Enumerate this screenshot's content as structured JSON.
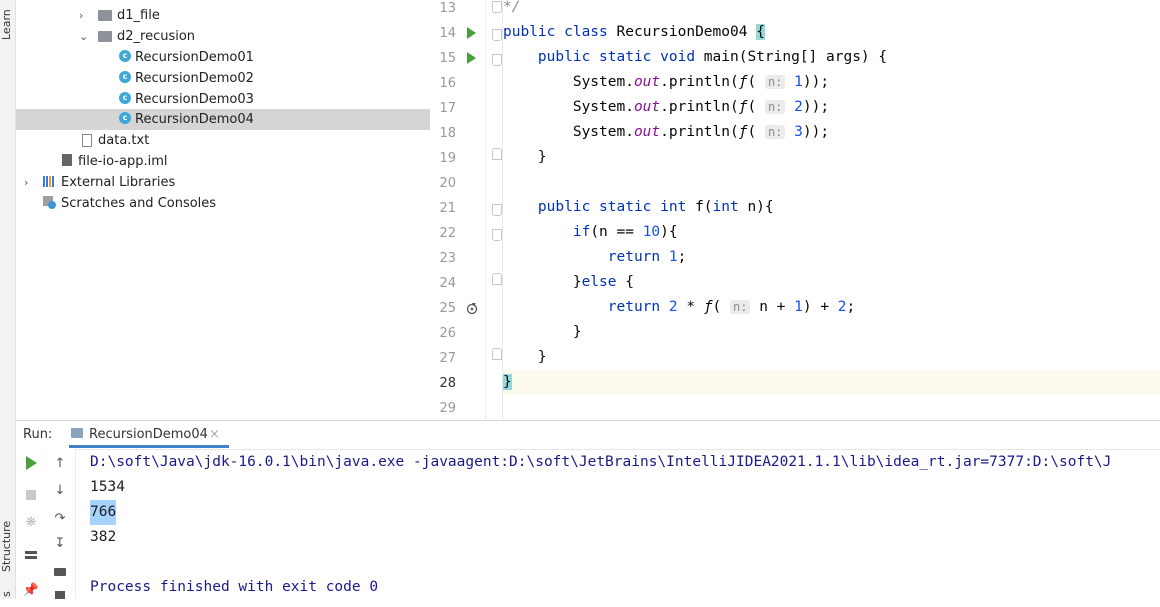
{
  "side_strip": {
    "top_label": "Learn",
    "bottom_label": "Structure",
    "bottom2_label": "s"
  },
  "project_tree": [
    {
      "label": "d1_file",
      "type": "folder",
      "expanded": false
    },
    {
      "label": "d2_recusion",
      "type": "folder",
      "expanded": true
    },
    {
      "label": "RecursionDemo01",
      "type": "class"
    },
    {
      "label": "RecursionDemo02",
      "type": "class"
    },
    {
      "label": "RecursionDemo03",
      "type": "class"
    },
    {
      "label": "RecursionDemo04",
      "type": "class",
      "selected": true
    },
    {
      "label": "data.txt",
      "type": "text-file"
    },
    {
      "label": "file-io-app.iml",
      "type": "iml-file"
    },
    {
      "label": "External Libraries",
      "type": "library",
      "expanded": false
    },
    {
      "label": "Scratches and Consoles",
      "type": "scratches"
    }
  ],
  "editor": {
    "line_numbers": [
      "13",
      "14",
      "15",
      "16",
      "17",
      "18",
      "19",
      "20",
      "21",
      "22",
      "23",
      "24",
      "25",
      "26",
      "27",
      "28",
      "29"
    ],
    "current_line": "28",
    "code": {
      "l13": "*/",
      "l14_kw": "public class ",
      "l14_name": "RecursionDemo04 ",
      "l14_brace": "{",
      "l15_kw": "public static void ",
      "l15_rest": "main(String[] args) {",
      "sys": "System.",
      "out": "out",
      "println": ".println(",
      "f": "ƒ",
      "paren_open": "( ",
      "hint_n": "n:",
      "arg1": "1",
      "arg2": "2",
      "arg3": "3",
      "close": "));",
      "brace_close": "}",
      "l21_kw": "public static int ",
      "l21_rest": "f(",
      "l21_int": "int ",
      "l21_end": "n){",
      "l22_if": "if",
      "l22_mid": "(n == ",
      "l22_num": "10",
      "l22_end": "){",
      "l23_ret": "return ",
      "l23_num": "1",
      "l23_end": ";",
      "l24_brace": "}",
      "l24_else": "else ",
      "l24_open": "{",
      "l25_ret": "return ",
      "l25_two": "2",
      "l25_mul": " * ",
      "l25_n1": " n + ",
      "l25_one": "1",
      "l25_plus": ") + ",
      "l25_two2": "2",
      "l25_end": ";"
    }
  },
  "run_panel": {
    "label": "Run:",
    "tab": "RecursionDemo04",
    "tab_close": "×",
    "console_lines": [
      "D:\\soft\\Java\\jdk-16.0.1\\bin\\java.exe -javaagent:D:\\soft\\JetBrains\\IntelliJIDEA2021.1.1\\lib\\idea_rt.jar=7377:D:\\soft\\J",
      "1534",
      "766",
      "382",
      "",
      "Process finished with exit code 0"
    ]
  },
  "colors": {
    "keyword": "#0033b3",
    "number": "#1750eb",
    "field": "#871094",
    "run_green": "#4a9f3d",
    "selection": "#a6d2ff"
  }
}
